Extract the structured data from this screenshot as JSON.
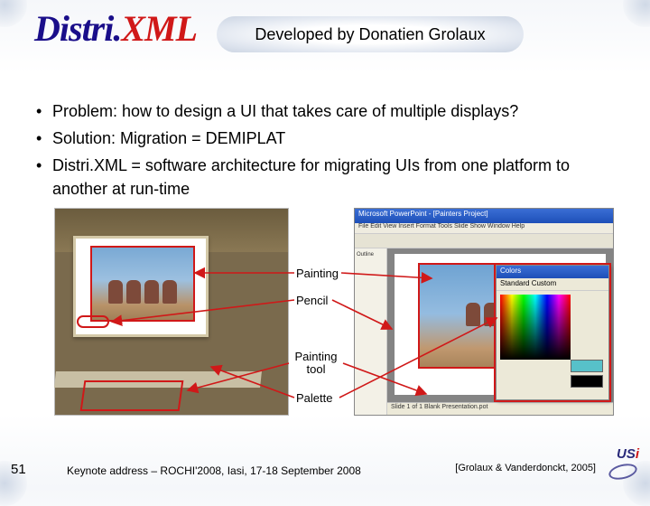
{
  "logo": {
    "part1": "Distri.",
    "part2": "XML"
  },
  "title": "Developed by Donatien Grolaux",
  "bullets": [
    "Problem: how to design a UI that takes care of multiple displays?",
    "Solution: Migration = DEMIPLAT",
    "Distri.XML = software architecture for migrating UIs from one platform to another at run-time"
  ],
  "labels": {
    "painting": "Painting",
    "pencil": "Pencil",
    "tool": "Painting tool",
    "palette": "Palette"
  },
  "screenshot": {
    "title": "Microsoft PowerPoint - [Painters Project]",
    "menu": "File  Edit  View  Insert  Format  Tools  Slide Show  Window  Help",
    "sidebar_tab": "Outline",
    "panel_title": "Colors",
    "panel_tabs": "Standard  Custom",
    "status": "Slide 1 of 1          Blank Presentation.pot"
  },
  "footer": {
    "slide_number": "51",
    "keynote": "Keynote address – ROCHI'2008, Iasi, 17-18 September 2008",
    "citation": "[Grolaux & Vanderdonckt, 2005]",
    "logo_text": "USi"
  }
}
